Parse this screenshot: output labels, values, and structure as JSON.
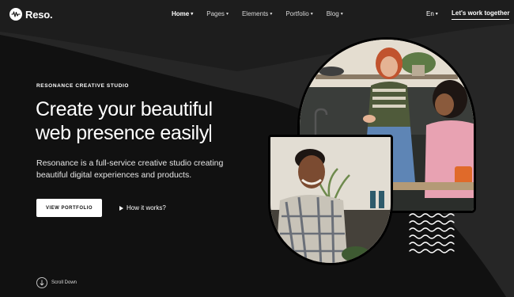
{
  "header": {
    "logo_text": "Reso.",
    "nav": [
      {
        "label": "Home",
        "active": true
      },
      {
        "label": "Pages"
      },
      {
        "label": "Elements"
      },
      {
        "label": "Portfolio"
      },
      {
        "label": "Blog"
      }
    ],
    "lang": "En",
    "cta": "Let's work together"
  },
  "hero": {
    "eyebrow": "RESONANCE CREATIVE STUDIO",
    "headline_line1": "Create your beautiful",
    "headline_line2": "web presence easily",
    "description": "Resonance is a full-service creative studio creating beautiful digital experiences and products.",
    "primary_button": "VIEW PORTFOLIO",
    "secondary_link": "How it works?",
    "scroll_label": "Scroll Down"
  },
  "colors": {
    "background": "#111111",
    "wave": "#2b2b2b",
    "text": "#ffffff"
  },
  "icons": [
    "logo-wave-icon",
    "chevron-down-icon",
    "play-icon",
    "arrow-down-icon"
  ]
}
